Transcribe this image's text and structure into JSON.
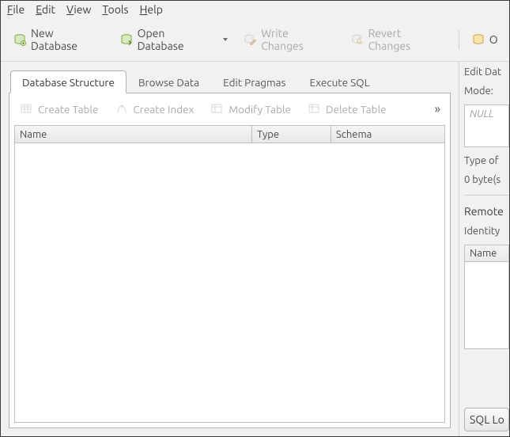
{
  "menu": {
    "file": {
      "key": "F",
      "rest": "ile"
    },
    "edit": {
      "key": "E",
      "rest": "dit"
    },
    "view": {
      "key": "V",
      "rest": "iew"
    },
    "tools": {
      "key": "T",
      "rest": "ools"
    },
    "help": {
      "key": "H",
      "rest": "elp"
    }
  },
  "toolbar": {
    "new_db": "New Database",
    "open_db": "Open Database",
    "write_changes": "Write Changes",
    "revert_changes": "Revert Changes",
    "open_project_hint": "O"
  },
  "tabs": {
    "db_structure": "Database Structure",
    "browse_data": "Browse Data",
    "edit_pragmas": "Edit Pragmas",
    "execute_sql": "Execute SQL"
  },
  "struct_toolbar": {
    "create_table": "Create Table",
    "create_index": "Create Index",
    "modify_table": "Modify Table",
    "delete_table": "Delete Table",
    "overflow": "»"
  },
  "columns": {
    "name": "Name",
    "type": "Type",
    "schema": "Schema"
  },
  "side": {
    "edit_cell_title": "Edit Dat",
    "mode_label": "Mode:",
    "null_placeholder": "NULL",
    "type_line": "Type of",
    "size_line": "0 byte(s",
    "remote_title": "Remote",
    "identity_label": "Identity",
    "name_col": "Name",
    "sql_log_btn": "SQL Lo"
  },
  "icons": {
    "db_accent": "#7aaa3a",
    "db_fill": "#d7e8c2",
    "pencil": "#caa646",
    "revert": "#caa646"
  }
}
